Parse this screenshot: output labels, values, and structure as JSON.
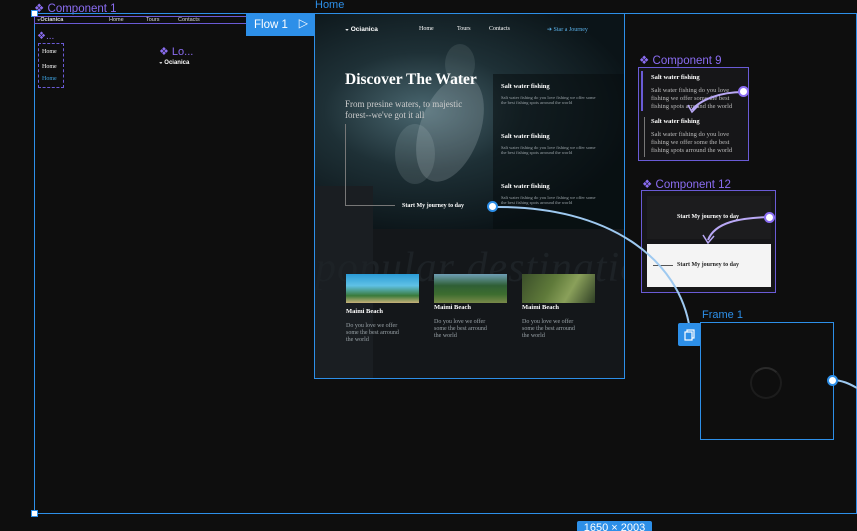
{
  "canvas": {
    "component1_label": "Component 1",
    "flow_tag": "Flow 1",
    "home_label": "Home",
    "component9_label": "Component 9",
    "component12_label": "Component 12",
    "frame1_label": "Frame 1",
    "size_badge": "1650 × 2003",
    "mini_nav": {
      "brand": "Ocianica",
      "home": "Home",
      "tours": "Tours",
      "contacts": "Contacts"
    },
    "variant_label": "❖...",
    "variant_items": [
      "Home",
      "Home",
      "Home"
    ],
    "logo_label": "❖ Lo...",
    "logo_brand": "Ocianica"
  },
  "site": {
    "brand": "Ocianica",
    "nav": [
      "Home",
      "Tours",
      "Contacts"
    ],
    "cta": "Star a Journey",
    "hero_title": "Discover The Water",
    "hero_sub_1": "From presine waters, to majestic",
    "hero_sub_2": "forest--we've got it all",
    "journey_btn": "Start My journey to day",
    "features": [
      {
        "title": "Salt water fishing",
        "text": "Salt water fishing do you love fishing we offer some the best fishing spots arround the world"
      },
      {
        "title": "Salt water fishing",
        "text": "Salt water fishing do you love fishing we offer some the best fishing spots arround the world"
      },
      {
        "title": "Salt water fishing",
        "text": "Salt water fishing do you love fishing we offer some the best fishing spots arround the world"
      }
    ],
    "bg_word": "popular destinations",
    "cards": [
      {
        "title": "Maimi Beach",
        "text_1": "Do you love we offer",
        "text_2": "some the best arround",
        "text_3": "the world"
      },
      {
        "title": "Maimi Beach",
        "text_1": "Do you love we offer",
        "text_2": "some the best arround",
        "text_3": "the world"
      },
      {
        "title": "Maimi Beach",
        "text_1": "Do you love we offer",
        "text_2": "some the best arround",
        "text_3": "the world"
      }
    ]
  },
  "component9": {
    "items": [
      {
        "title": "Salt water fishing",
        "text_1": "Salt water fishing do you love",
        "text_2": "fishing we offer some the best",
        "text_3": "fishing spots arround the world"
      },
      {
        "title": "Salt water fishing",
        "text_1": "Salt water fishing do you love",
        "text_2": "fishing we offer some the best",
        "text_3": "fishing spots arround the world"
      }
    ]
  },
  "component12": {
    "dark_btn": "Start My journey to day",
    "light_btn": "Start My journey to day"
  },
  "colors": {
    "selection": "#2d8fe8",
    "component": "#8b6df2",
    "canvas": "#0e0e0e"
  }
}
